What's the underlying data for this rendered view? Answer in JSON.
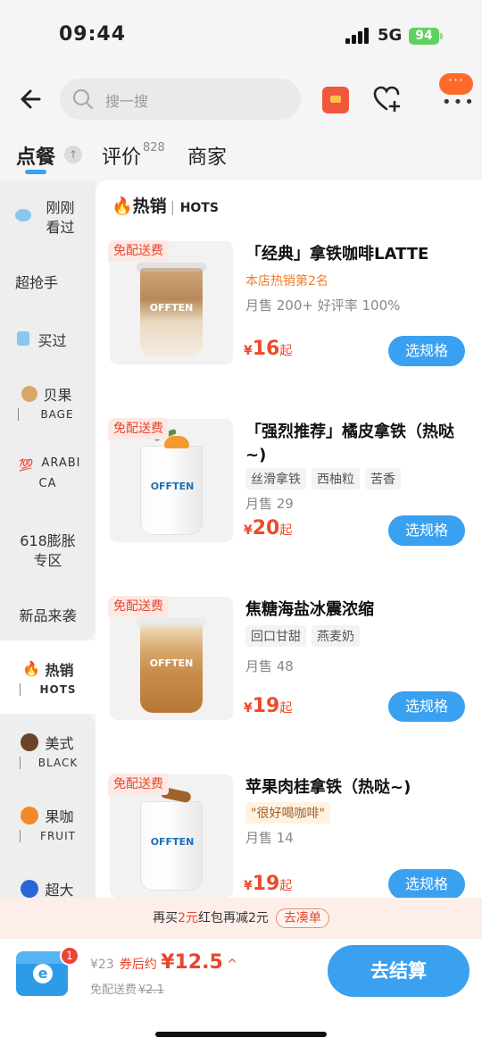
{
  "status_bar": {
    "time": "09:44",
    "network": "5G",
    "battery": "94"
  },
  "search": {
    "placeholder": "搜一搜"
  },
  "tabs": [
    {
      "label": "点餐"
    },
    {
      "label": "评价",
      "count": "828"
    },
    {
      "label": "商家"
    }
  ],
  "sidebar": {
    "items": [
      {
        "label": "刚刚看过",
        "line1": "刚刚",
        "line2": "看过"
      },
      {
        "label": "超抢手"
      },
      {
        "label": "买过"
      },
      {
        "label": "贝果",
        "sub": "BAGE"
      },
      {
        "label": "ARABICA",
        "line1": "ARABI",
        "line2": "CA"
      },
      {
        "label": "618膨胀专区",
        "line1": "618膨胀",
        "line2": "专区"
      },
      {
        "label": "新品来袭"
      },
      {
        "label": "热销",
        "sub": "HOTS"
      },
      {
        "label": "美式",
        "sub": "BLACK"
      },
      {
        "label": "果咖",
        "sub": "FRUIT"
      },
      {
        "label": "超大"
      }
    ]
  },
  "section": {
    "title": "热销",
    "subtitle": "HOTS"
  },
  "products": [
    {
      "free_tag": "免配送费",
      "name": "「经典」拿铁咖啡LATTE",
      "rank": "本店热销第2名",
      "sales": "月售 200+ 好评率 100%",
      "currency": "¥",
      "price": "16",
      "price_suffix": "起",
      "button": "选规格"
    },
    {
      "free_tag": "免配送费",
      "name": "「强烈推荐」橘皮拿铁（热哒~)",
      "tags": [
        "丝滑拿铁",
        "西柚粒",
        "苦香"
      ],
      "sales": "月售 29",
      "currency": "¥",
      "price": "20",
      "price_suffix": "起",
      "button": "选规格"
    },
    {
      "free_tag": "免配送费",
      "name": "焦糖海盐冰震浓缩",
      "tags": [
        "回口甘甜",
        "燕麦奶"
      ],
      "sales": "月售 48",
      "currency": "¥",
      "price": "19",
      "price_suffix": "起",
      "button": "选规格"
    },
    {
      "free_tag": "免配送费",
      "name": "苹果肉桂拿铁（热哒~)",
      "quote": "\"很好喝咖啡\"",
      "sales": "月售 14",
      "currency": "¥",
      "price": "19",
      "price_suffix": "起",
      "button": "选规格"
    }
  ],
  "promo": {
    "prefix": "再买",
    "amount": "2元",
    "middle": "红包再减2元",
    "button": "去凑单"
  },
  "cart": {
    "badge": "1",
    "original": "¥23",
    "after_label": "券后约",
    "after_price": "¥12.5",
    "delivery_label": "免配送费",
    "delivery_old": "¥2.1",
    "checkout": "去结算"
  },
  "brand_on_cup": "OFFTEN",
  "colors": {
    "accent": "#3aa0f0",
    "price": "#ec4b2b",
    "promo_bg": "#fdeeea"
  }
}
